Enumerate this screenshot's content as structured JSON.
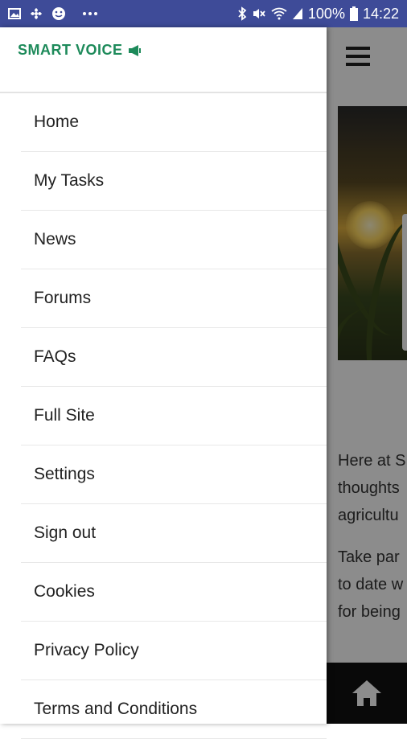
{
  "status_bar": {
    "left_icons": [
      "image-icon",
      "fan-icon",
      "smiley-icon",
      "more-icon"
    ],
    "battery_percent": "100%",
    "time": "14:22"
  },
  "drawer": {
    "logo_text": "SMART VOICE",
    "menu_items": [
      {
        "label": "Home"
      },
      {
        "label": "My Tasks"
      },
      {
        "label": "News"
      },
      {
        "label": "Forums"
      },
      {
        "label": "FAQs"
      },
      {
        "label": "Full Site"
      },
      {
        "label": "Settings"
      },
      {
        "label": "Sign out"
      },
      {
        "label": "Cookies"
      },
      {
        "label": "Privacy Policy"
      },
      {
        "label": "Terms and Conditions"
      }
    ]
  },
  "background": {
    "intro_lines": [
      "Here at S",
      "thoughts",
      "agricultu"
    ],
    "second_lines": [
      "Take par",
      "to date w",
      "for being"
    ]
  },
  "colors": {
    "status_bar": "#3e4b98",
    "brand": "#1d8a5a"
  }
}
